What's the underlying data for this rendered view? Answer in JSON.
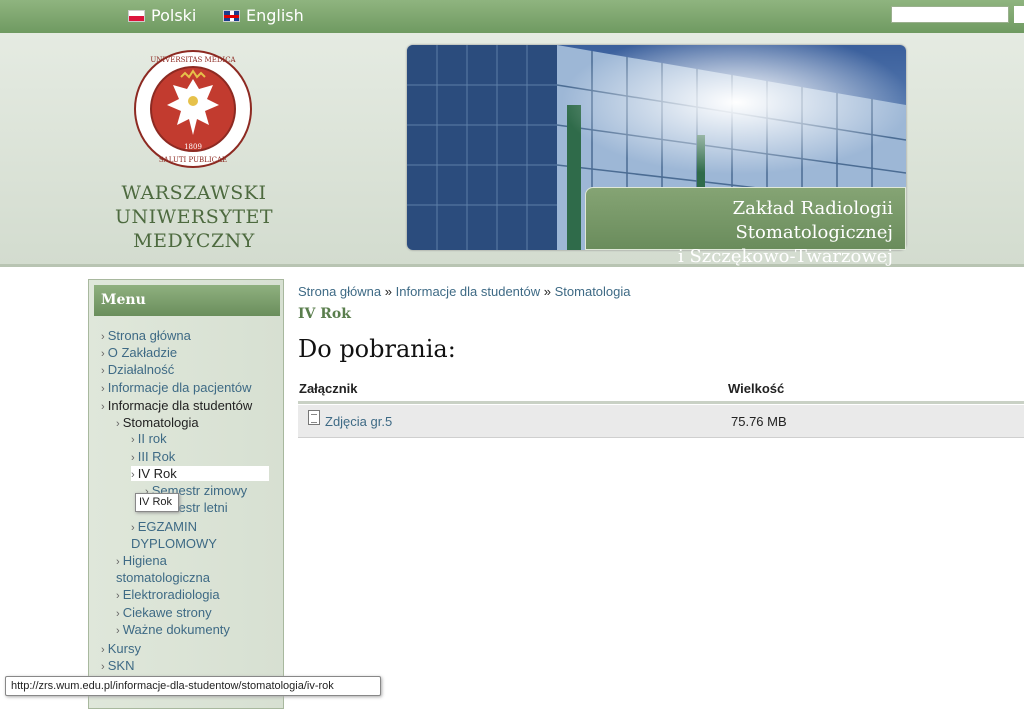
{
  "topbar": {
    "languages": [
      {
        "label": "Polski",
        "flag": "pl-flag-icon"
      },
      {
        "label": "English",
        "flag": "gb-flag-icon"
      }
    ],
    "search_value": ""
  },
  "header": {
    "logo_text": "UNIVERSITAS MEDICA VARSOVIENSIS · SALUTI PUBLICAE · 1809",
    "university_name": [
      "WARSZAWSKI",
      "UNIWERSYTET",
      "MEDYCZNY"
    ],
    "banner_caption": [
      "Zakład Radiologii Stomatologicznej",
      "i Szczękowo-Twarzowej"
    ]
  },
  "sidebar": {
    "title": "Menu",
    "items": [
      {
        "label": "Strona główna"
      },
      {
        "label": "O Zakładzie"
      },
      {
        "label": "Działalność"
      },
      {
        "label": "Informacje dla pacjentów"
      },
      {
        "label": "Informacje dla studentów"
      },
      {
        "label": "Stomatologia"
      },
      {
        "label": "II rok"
      },
      {
        "label": "III Rok"
      },
      {
        "label": "IV Rok"
      },
      {
        "label": "Semestr zimowy"
      },
      {
        "label": "Semestr letni"
      },
      {
        "label": "EGZAMIN DYPLOMOWY"
      },
      {
        "label": "Higiena stomatologiczna"
      },
      {
        "label": "Elektroradiologia"
      },
      {
        "label": "Ciekawe strony"
      },
      {
        "label": "Ważne dokumenty"
      },
      {
        "label": "Kursy"
      },
      {
        "label": "SKN"
      }
    ],
    "tooltip": "IV Rok"
  },
  "breadcrumb": {
    "items": [
      "Strona główna",
      "Informacje dla studentów",
      "Stomatologia"
    ],
    "separator": "»"
  },
  "main": {
    "subtitle": "IV Rok",
    "title": "Do pobrania:",
    "table": {
      "headers": [
        "Załącznik",
        "Wielkość"
      ],
      "rows": [
        {
          "file": "Zdjęcia gr.5",
          "size": "75.76 MB"
        }
      ]
    }
  },
  "statusbar": {
    "url": "http://zrs.wum.edu.pl/informacje-dla-studentow/stomatologia/iv-rok"
  },
  "colors": {
    "accent_green": "#6f9a61",
    "link_blue": "#3e6a85",
    "title_green": "#5a7e4d"
  }
}
